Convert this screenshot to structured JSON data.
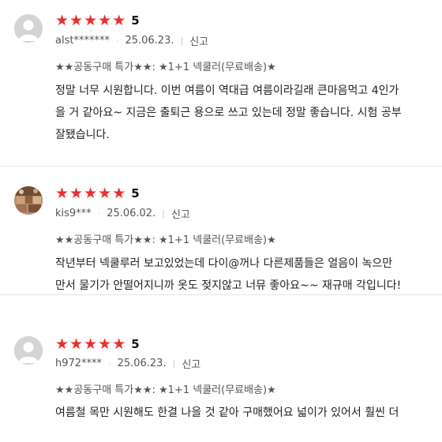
{
  "reviews": [
    {
      "rating_value": 5,
      "score_label": "5",
      "user": "alst*******",
      "date": "25.06.23.",
      "report_label": "신고",
      "option": "★★공동구매 특가★★: ★1+1 넥쿨러(무료배송)★",
      "body_lines": [
        "정말 너무 시원합니다. 이번 여름이 역대급 여름이라길래 큰마음먹고 4인가",
        "을 거 같아요~ 지금은 출퇴근 용으로 쓰고 있는데 정말 좋습니다. 시험 공부",
        "잘됐습니다."
      ],
      "avatar": "default-user-icon"
    },
    {
      "rating_value": 5,
      "score_label": "5",
      "user": "kis9***",
      "date": "25.06.02.",
      "report_label": "신고",
      "option": "★★공동구매 특가★★: ★1+1 넥쿨러(무료배송)★",
      "body_lines": [
        "작년부터 넥쿨루러 보고있었는데 다이@꺼나 다른제품들은 얼음이 녹으만",
        "만서 물기가 안떨어지니까 옷도 젖지않고 너뮤 좋아요~~ 재규매 각입니다!"
      ],
      "avatar": "photo-avatar"
    },
    {
      "rating_value": 5,
      "score_label": "5",
      "user": "h972****",
      "date": "25.06.23.",
      "report_label": "신고",
      "option": "★★공동구매 특가★★: ★1+1 넥쿨러(무료배송)★",
      "body_lines": [
        "여름철 목만 시원해도 한결 나을 것 같아 구매했어요 넓이가 있어서 훨씬 더"
      ],
      "avatar": "default-user-icon"
    }
  ],
  "colors": {
    "star": "#ea2f2f",
    "divider": "#e6e6e6",
    "avatar_bg": "#d4d4d4"
  }
}
